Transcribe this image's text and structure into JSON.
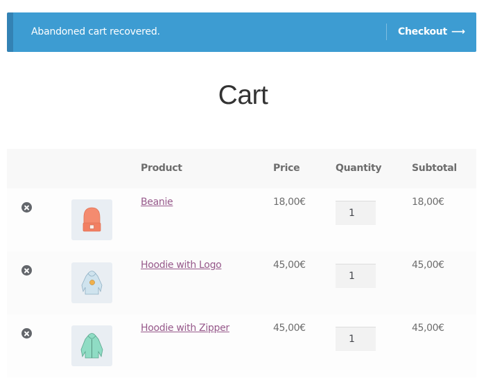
{
  "notice": {
    "message": "Abandoned cart recovered.",
    "button_label": "Checkout",
    "button_icon": "arrow-right-icon",
    "arrow_glyph": "⟶",
    "background": "#3d9cd2"
  },
  "page": {
    "title": "Cart"
  },
  "table": {
    "columns": {
      "remove": "",
      "thumbnail": "",
      "product": "Product",
      "price": "Price",
      "quantity": "Quantity",
      "subtotal": "Subtotal"
    },
    "rows": [
      {
        "name": "Beanie",
        "price": "18,00€",
        "quantity": "1",
        "subtotal": "18,00€",
        "thumbnail": "beanie-image"
      },
      {
        "name": "Hoodie with Logo",
        "price": "45,00€",
        "quantity": "1",
        "subtotal": "45,00€",
        "thumbnail": "hoodie-with-logo-image"
      },
      {
        "name": "Hoodie with Zipper",
        "price": "45,00€",
        "quantity": "1",
        "subtotal": "45,00€",
        "thumbnail": "hoodie-with-zipper-image"
      }
    ]
  },
  "colors": {
    "link": "#96588a",
    "remove_icon": "#63666b"
  }
}
